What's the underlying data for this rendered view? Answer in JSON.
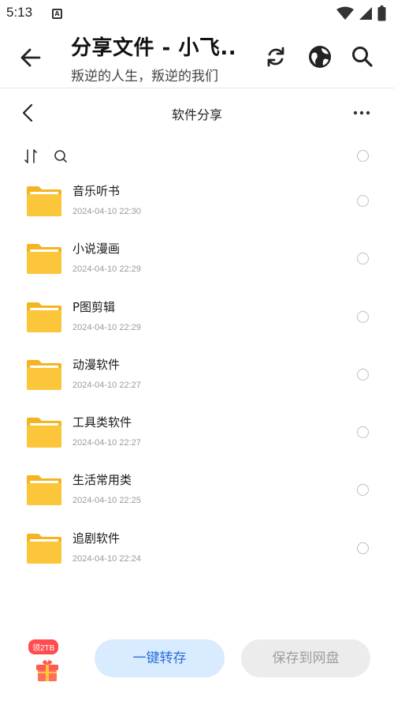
{
  "status_bar": {
    "time": "5:13",
    "notification_icon": "A",
    "icons": [
      "wifi-icon",
      "signal-icon",
      "battery-icon"
    ]
  },
  "app_bar": {
    "title": "分享文件 - 小飞...",
    "subtitle": "叛逆的人生，叛逆的我们",
    "icons": [
      "back-arrow-icon",
      "refresh-icon",
      "globe-icon",
      "search-icon"
    ]
  },
  "folder_header": {
    "name": "软件分享",
    "icons": [
      "chevron-left-icon",
      "more-icon"
    ]
  },
  "tools": {
    "icons": [
      "sort-icon",
      "search-icon"
    ]
  },
  "files": [
    {
      "name": "音乐听书",
      "date": "2024-04-10 22:30"
    },
    {
      "name": "小说漫画",
      "date": "2024-04-10 22:29"
    },
    {
      "name": "P图剪辑",
      "date": "2024-04-10 22:29"
    },
    {
      "name": "动漫软件",
      "date": "2024-04-10 22:27"
    },
    {
      "name": "工具类软件",
      "date": "2024-04-10 22:27"
    },
    {
      "name": "生活常用类",
      "date": "2024-04-10 22:25"
    },
    {
      "name": "追剧软件",
      "date": "2024-04-10 22:24"
    }
  ],
  "bottom": {
    "gift_badge": "领2TB",
    "transfer_label": "一键转存",
    "save_label": "保存到网盘"
  },
  "colors": {
    "folder": "#fcc63a",
    "folder_tab": "#f5b521",
    "accent": "#2b6fd8",
    "accent_bg": "#d8ebff",
    "badge": "#ff4d4f"
  }
}
